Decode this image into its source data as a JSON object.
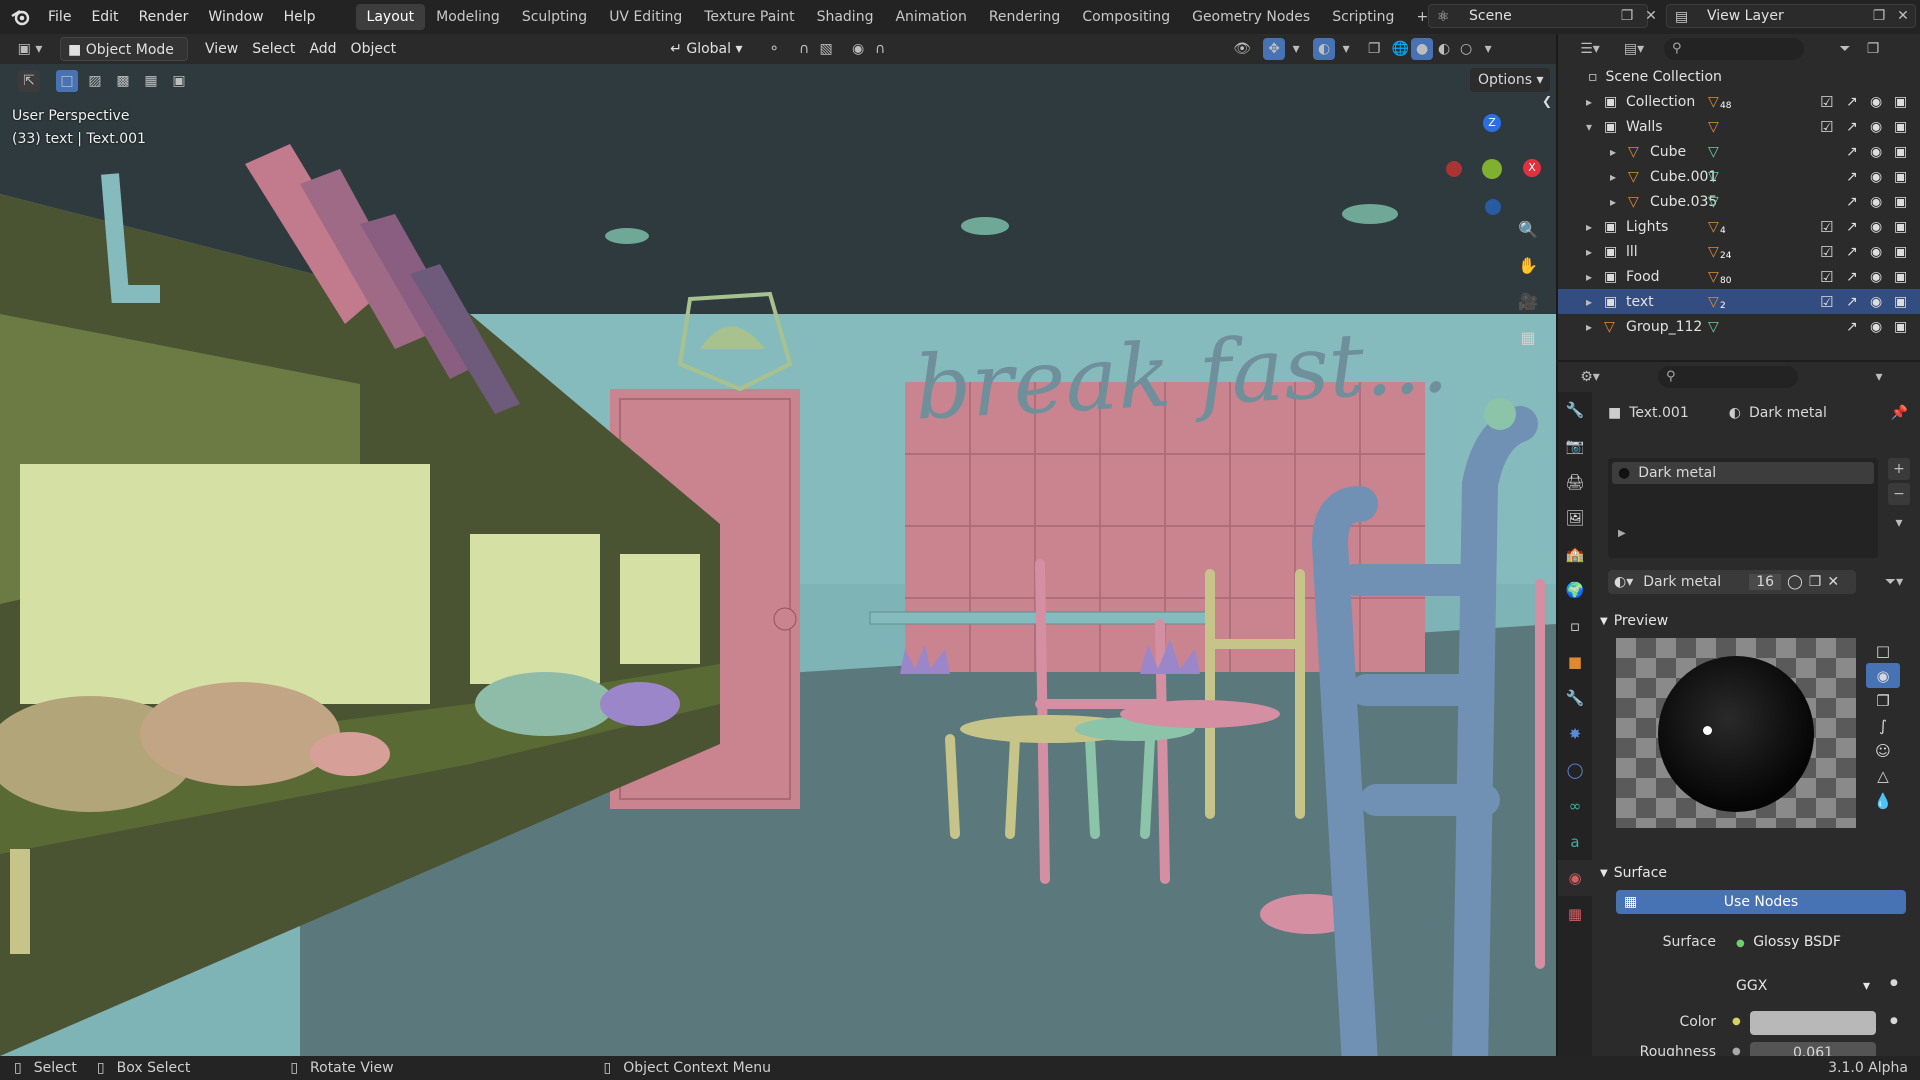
{
  "topbar": {
    "menus": [
      "File",
      "Edit",
      "Render",
      "Window",
      "Help"
    ],
    "workspaces": [
      "Layout",
      "Modeling",
      "Sculpting",
      "UV Editing",
      "Texture Paint",
      "Shading",
      "Animation",
      "Rendering",
      "Compositing",
      "Geometry Nodes",
      "Scripting"
    ],
    "active_workspace": "Layout",
    "add_tab": "+",
    "scene": "Scene",
    "view_layer": "View Layer"
  },
  "viewport_header": {
    "mode": "Object Mode",
    "menus": [
      "View",
      "Select",
      "Add",
      "Object"
    ],
    "orientation": "Global",
    "options": "Options"
  },
  "viewport": {
    "perspective": "User Perspective",
    "active_info": "(33) text | Text.001",
    "sign_text": "break fast...",
    "gizmo": {
      "z": "Z",
      "x": "X"
    }
  },
  "outliner": {
    "root": "Scene Collection",
    "rows": [
      {
        "name": "Collection",
        "badge": "48",
        "indent": 0,
        "kind": "collection",
        "selected": false,
        "checkbox": true
      },
      {
        "name": "Walls",
        "badge": "",
        "indent": 0,
        "kind": "collection",
        "selected": false,
        "checkbox": true,
        "expanded": true
      },
      {
        "name": "Cube",
        "badge": "",
        "indent": 1,
        "kind": "mesh",
        "selected": false,
        "checkbox": false
      },
      {
        "name": "Cube.001",
        "badge": "",
        "indent": 1,
        "kind": "mesh",
        "selected": false,
        "checkbox": false
      },
      {
        "name": "Cube.035",
        "badge": "",
        "indent": 1,
        "kind": "mesh",
        "selected": false,
        "checkbox": false
      },
      {
        "name": "Lights",
        "badge": "4",
        "indent": 0,
        "kind": "collection",
        "selected": false,
        "checkbox": true
      },
      {
        "name": "lll",
        "badge": "24",
        "indent": 0,
        "kind": "collection",
        "selected": false,
        "checkbox": true
      },
      {
        "name": "Food",
        "badge": "80",
        "indent": 0,
        "kind": "collection",
        "selected": false,
        "checkbox": true
      },
      {
        "name": "text",
        "badge": "2",
        "badge2": "2",
        "indent": 0,
        "kind": "collection",
        "selected": true,
        "checkbox": true
      },
      {
        "name": "Group_112",
        "badge": "",
        "indent": 0,
        "kind": "mesh",
        "selected": false,
        "checkbox": false
      }
    ]
  },
  "properties": {
    "object": "Text.001",
    "material": "Dark metal",
    "slot_name": "Dark metal",
    "datablock": "Dark metal",
    "users": "16",
    "preview_label": "Preview",
    "surface_label": "Surface",
    "use_nodes": "Use Nodes",
    "surface_prop_label": "Surface",
    "surface_value": "Glossy BSDF",
    "distribution": "GGX",
    "color_label": "Color",
    "roughness_label": "Roughness",
    "roughness_value": "0.061"
  },
  "status": {
    "select": "Select",
    "box_select": "Box Select",
    "rotate": "Rotate View",
    "context_menu": "Object Context Menu",
    "version": "3.1.0 Alpha"
  },
  "colors": {
    "accent": "#4772b3",
    "selected_row": "#334d80",
    "wall": "#7fb4b6",
    "pink": "#c9848f"
  }
}
